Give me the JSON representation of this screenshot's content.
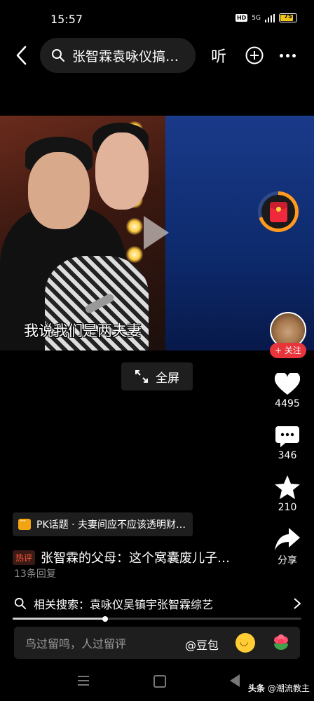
{
  "status_bar": {
    "time": "15:57",
    "network": "5G",
    "battery": "75"
  },
  "header": {
    "search_text": "张智霖袁咏仪搞…",
    "listen_label": "听"
  },
  "video": {
    "subtitle": "我说我们是两夫妻"
  },
  "fullscreen": {
    "label": "全屏"
  },
  "author": {
    "follow_label": "+ 关注"
  },
  "actions": {
    "likes": "4495",
    "comments": "346",
    "favorites": "210",
    "share_label": "分享"
  },
  "pk_topic": {
    "text": "PK话题 · 夫妻间应不应该透明财…"
  },
  "hot_comment": {
    "tag": "热评",
    "text": "张智霖的父母：这个窝囊废儿子…",
    "replies": "13条回复"
  },
  "related_search": {
    "text": "相关搜索：袁咏仪吴镇宇张智霖综艺"
  },
  "playback": {
    "progress": 0.32
  },
  "comment_input": {
    "placeholder": "鸟过留鸣，人过留评",
    "mention": "@豆包"
  },
  "watermark": {
    "platform": "头条",
    "account": "@潮流教主"
  },
  "colors": {
    "accent_red": "#e8343b",
    "pk_orange": "#f3a413",
    "hot_tag": "#ff5a3c"
  }
}
